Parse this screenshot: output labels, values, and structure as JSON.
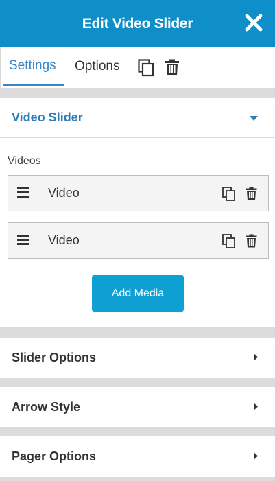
{
  "header": {
    "title": "Edit Video Slider",
    "close_icon": "close-icon",
    "color": "#0e8fc9"
  },
  "tabs": {
    "settings_label": "Settings",
    "options_label": "Options",
    "active": "Settings",
    "copy_icon": "copy-icon",
    "delete_icon": "trash-icon"
  },
  "video_slider": {
    "title": "Video Slider",
    "expanded": true,
    "videos_label": "Videos",
    "items": [
      {
        "label": "Video"
      },
      {
        "label": "Video"
      }
    ],
    "add_media_label": "Add Media"
  },
  "sections": [
    {
      "title": "Slider Options"
    },
    {
      "title": "Arrow Style"
    },
    {
      "title": "Pager Options"
    }
  ]
}
